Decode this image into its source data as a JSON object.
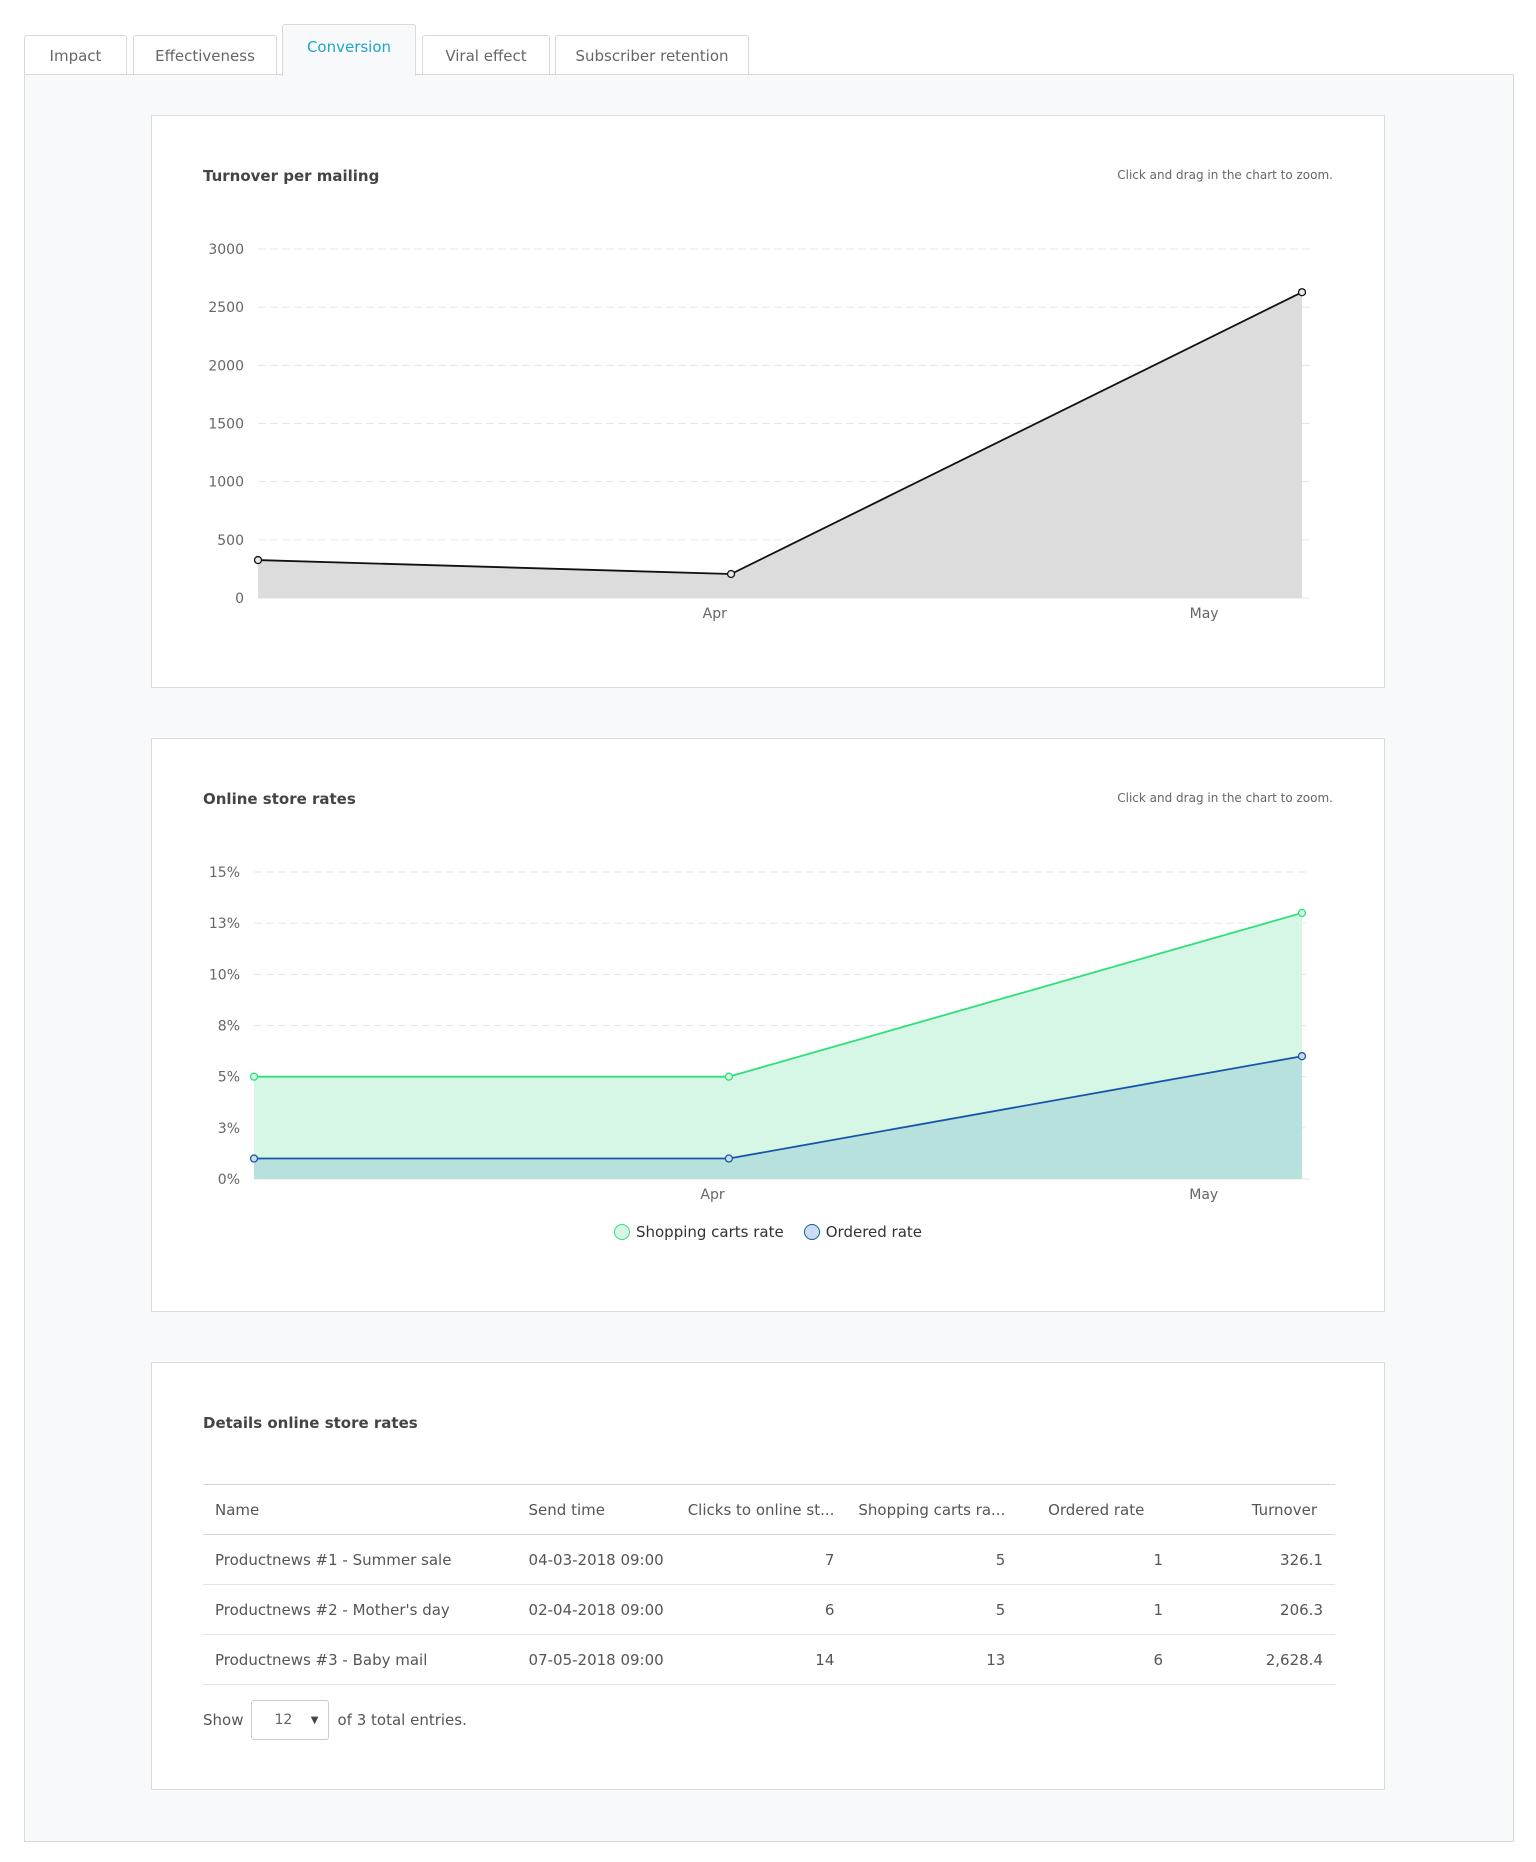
{
  "tabs": [
    {
      "label": "Impact",
      "active": false
    },
    {
      "label": "Effectiveness",
      "active": false
    },
    {
      "label": "Conversion",
      "active": true
    },
    {
      "label": "Viral effect",
      "active": false
    },
    {
      "label": "Subscriber retention",
      "active": false
    }
  ],
  "colors": {
    "accent": "#1fa5c8",
    "turnover_fill": "#dcdcdc",
    "turnover_line": "#111111",
    "shopping_line": "#2ee07a",
    "shopping_fill": "#d6f7e6",
    "ordered_line": "#1a56a8",
    "ordered_fill": "#b6e1dc"
  },
  "turnover_card": {
    "title": "Turnover per mailing",
    "zoom_hint": "Click and drag in the chart to zoom."
  },
  "rates_card": {
    "title": "Online store rates",
    "zoom_hint": "Click and drag in the chart to zoom."
  },
  "chart_data": [
    {
      "type": "area",
      "title": "Turnover per mailing",
      "x": [
        "2018-03-04",
        "2018-04-02",
        "2018-05-07"
      ],
      "x_ticks": [
        "Apr",
        "May"
      ],
      "ylim": [
        0,
        3000
      ],
      "y_ticks": [
        "0",
        "500",
        "1000",
        "1500",
        "2000",
        "2500",
        "3000"
      ],
      "grid": true,
      "series": [
        {
          "values": [
            326.1,
            206.3,
            2628.4
          ]
        }
      ]
    },
    {
      "type": "area",
      "title": "Online store rates",
      "x": [
        "2018-03-04",
        "2018-04-02",
        "2018-05-07"
      ],
      "x_ticks": [
        "Apr",
        "May"
      ],
      "ylim": [
        0,
        15
      ],
      "y_ticks": [
        "0%",
        "3%",
        "5%",
        "8%",
        "10%",
        "13%",
        "15%"
      ],
      "grid": true,
      "legend_position": "bottom",
      "series": [
        {
          "name": "Shopping carts rate",
          "values": [
            5,
            5,
            13
          ]
        },
        {
          "name": "Ordered rate",
          "values": [
            1,
            1,
            6
          ]
        }
      ]
    }
  ],
  "details": {
    "title": "Details online store rates",
    "columns": [
      "Name",
      "Send time",
      "Clicks to online st...",
      "Shopping carts ra...",
      "Ordered rate",
      "Turnover"
    ],
    "rows": [
      [
        "Productnews #1 - Summer sale",
        "04-03-2018 09:00",
        "7",
        "5",
        "1",
        "326.1"
      ],
      [
        "Productnews #2 - Mother's day",
        "02-04-2018 09:00",
        "6",
        "5",
        "1",
        "206.3"
      ],
      [
        "Productnews #3 - Baby mail",
        "07-05-2018 09:00",
        "14",
        "13",
        "6",
        "2,628.4"
      ]
    ],
    "pager": {
      "show_label": "Show",
      "page_size": "12",
      "total_text": "of 3 total entries."
    }
  }
}
